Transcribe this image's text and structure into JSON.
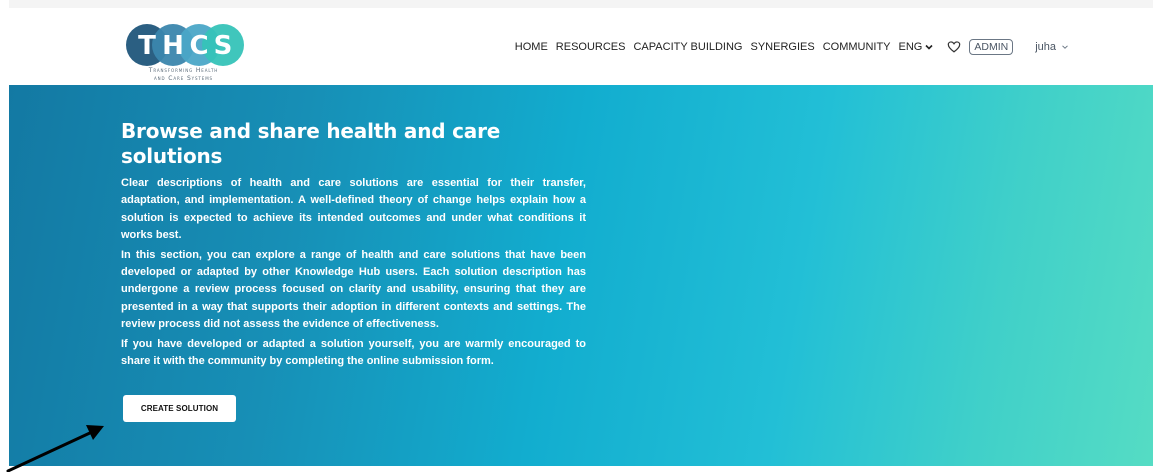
{
  "brand": {
    "logo_letters": "THCS",
    "tagline_line1": "Transforming Health",
    "tagline_line2": "and Care Systems",
    "colors": {
      "circle_dark": "#2b5f82",
      "circle_mid": "#3b86ad",
      "circle_light": "#36c3b8"
    }
  },
  "nav": {
    "items": [
      {
        "label": "HOME"
      },
      {
        "label": "RESOURCES"
      },
      {
        "label": "CAPACITY BUILDING"
      },
      {
        "label": "SYNERGIES"
      },
      {
        "label": "COMMUNITY"
      }
    ],
    "language": {
      "label": "ENG",
      "icon": "chevron-down-icon"
    },
    "favorites_icon": "heart-icon",
    "admin_label": "ADMIN",
    "user": {
      "label": "juha",
      "icon": "chevron-down-icon"
    }
  },
  "hero": {
    "title": "Browse and share health and care solutions",
    "paragraphs": [
      "Clear descriptions of health and care solutions are essential for their transfer, adaptation, and implementation. A well-defined theory of change helps explain how a solution is expected to achieve its intended outcomes and under what conditions it works best.",
      "In this section, you can explore a range of health and care solutions that have been developed or adapted by other Knowledge Hub users. Each solution description has undergone a review process focused on clarity and usability, ensuring that they are presented in a way that supports their adoption in different contexts and settings. The review process did not assess the evidence of effectiveness.",
      "If you have developed or adapted a solution yourself, you are warmly encouraged to share it with the community by completing the online submission form."
    ],
    "cta_label": "CREATE SOLUTION",
    "gradient": [
      "#1379a3",
      "#12adcf",
      "#55dcc4"
    ]
  },
  "annotation": {
    "icon": "pointer-arrow-icon",
    "color": "#000000"
  }
}
